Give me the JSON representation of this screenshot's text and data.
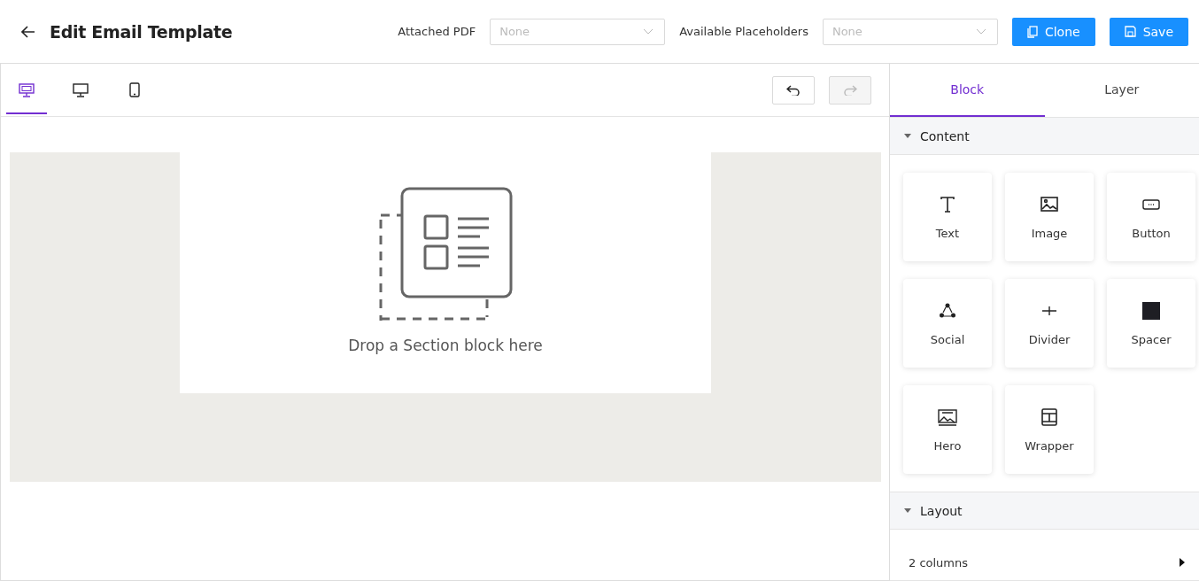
{
  "header": {
    "title": "Edit Email Template",
    "attached_pdf": {
      "label": "Attached PDF",
      "placeholder": "None"
    },
    "placeholders": {
      "label": "Available Placeholders",
      "placeholder": "None"
    },
    "buttons": [
      {
        "kind": "clone",
        "label": "Clone"
      },
      {
        "kind": "save",
        "label": "Save"
      }
    ]
  },
  "device_tabs": [
    {
      "kind": "responsive",
      "selected": true
    },
    {
      "kind": "desktop",
      "selected": false
    },
    {
      "kind": "mobile",
      "selected": false
    }
  ],
  "history": [
    {
      "kind": "undo",
      "disabled": false
    },
    {
      "kind": "redo",
      "disabled": true
    }
  ],
  "canvas": {
    "drop_hint": "Drop a Section block here"
  },
  "panel_tabs": [
    {
      "label": "Block",
      "selected": true
    },
    {
      "label": "Layer",
      "selected": false
    }
  ],
  "sections": [
    {
      "title": "Content",
      "expanded": true,
      "blocks": [
        {
          "kind": "text",
          "label": "Text"
        },
        {
          "kind": "image",
          "label": "Image"
        },
        {
          "kind": "button",
          "label": "Button"
        },
        {
          "kind": "social",
          "label": "Social"
        },
        {
          "kind": "divider",
          "label": "Divider"
        },
        {
          "kind": "spacer",
          "label": "Spacer"
        },
        {
          "kind": "hero",
          "label": "Hero"
        },
        {
          "kind": "wrapper",
          "label": "Wrapper"
        }
      ]
    },
    {
      "title": "Layout",
      "expanded": true,
      "items": [
        {
          "label": "2 columns"
        }
      ]
    }
  ]
}
